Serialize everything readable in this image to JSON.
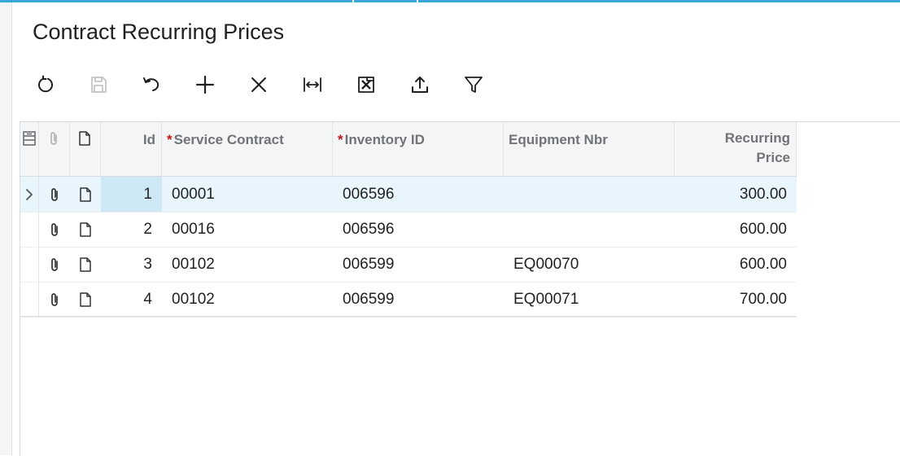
{
  "page": {
    "title": "Contract Recurring Prices"
  },
  "toolbar": {
    "buttons": [
      {
        "name": "refresh-button",
        "icon": "refresh-icon",
        "enabled": true
      },
      {
        "name": "save-button",
        "icon": "save-icon",
        "enabled": false
      },
      {
        "name": "undo-button",
        "icon": "undo-icon",
        "enabled": true
      },
      {
        "name": "add-button",
        "icon": "plus-icon",
        "enabled": true
      },
      {
        "name": "delete-button",
        "icon": "close-icon",
        "enabled": true
      },
      {
        "name": "fit-columns-button",
        "icon": "fit-width-icon",
        "enabled": true
      },
      {
        "name": "export-excel-button",
        "icon": "excel-icon",
        "enabled": true
      },
      {
        "name": "upload-button",
        "icon": "upload-icon",
        "enabled": true
      },
      {
        "name": "filter-button",
        "icon": "filter-icon",
        "enabled": true
      }
    ]
  },
  "grid": {
    "columns": {
      "id": "Id",
      "service_contract": "Service Contract",
      "inventory_id": "Inventory ID",
      "equipment_nbr": "Equipment Nbr",
      "recurring_price_1": "Recurring",
      "recurring_price_2": "Price",
      "required_mark": "*"
    },
    "rows": [
      {
        "id": "1",
        "service_contract": "00001",
        "inventory_id": "006596",
        "equipment_nbr": "",
        "recurring_price": "300.00",
        "selected": true
      },
      {
        "id": "2",
        "service_contract": "00016",
        "inventory_id": "006596",
        "equipment_nbr": "",
        "recurring_price": "600.00",
        "selected": false
      },
      {
        "id": "3",
        "service_contract": "00102",
        "inventory_id": "006599",
        "equipment_nbr": "EQ00070",
        "recurring_price": "600.00",
        "selected": false
      },
      {
        "id": "4",
        "service_contract": "00102",
        "inventory_id": "006599",
        "equipment_nbr": "EQ00071",
        "recurring_price": "700.00",
        "selected": false
      }
    ]
  },
  "colors": {
    "accent": "#3aa6dc",
    "required": "#c4161c",
    "selected_row": "#e8f5fc"
  }
}
